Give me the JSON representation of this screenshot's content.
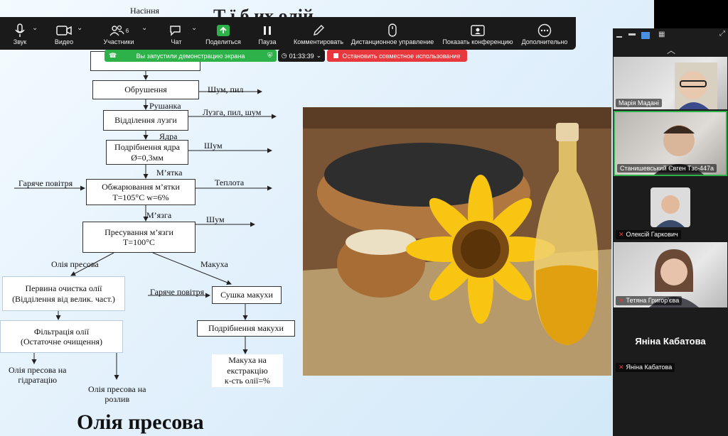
{
  "slide": {
    "title_fragment": "Т                ї       б                                     их олій",
    "top_label": "Насіння",
    "bottom_title": "Олія пресова",
    "boxes": {
      "obrushennya": "Обрушення",
      "viddilennya_luzgy": "Відділення лузги",
      "podribnennya_yadra": "Подрібнення ядра\nØ=0,3мм",
      "obzharyuvannya": "Обжарювання  м’ятки\nT=105°C  w=6%",
      "presuvannya": "Пресування м’язги\nT=100°C",
      "pervynna": "Первина очистка олії\n(Відділення від велик. част.)",
      "filtratsiya": "Фільтрація олії\n(Остаточне очищення)",
      "sushka": "Сушка макухи",
      "podribnennya_makukhy": "Подрібнення макухи"
    },
    "labels": {
      "shum_pyl": "Шум, пил",
      "rushanka": "Рушанка",
      "luzga_pyl_shum": "Лузга, пил, шум",
      "yadra": "Ядра",
      "shum1": "Шум",
      "myatka": "М’ятка",
      "gariache1": "Гаряче повітря",
      "teplota": "Теплота",
      "myazga": "М’язга",
      "shum2": "Шум",
      "oliya_presova": "Олія пресова",
      "makukha": "Макуха",
      "gariache2": "Гаряче повітря",
      "na_gidrataciyu": "Олія пресова на\nгідратацію",
      "na_rozlyv": "Олія пресова на\nрозлив",
      "makukha_extr": "Макуха на\nекстракцію\nк-сть олії=%"
    }
  },
  "toolbar": {
    "items": [
      {
        "label": "Звук",
        "icon": "microphone-icon"
      },
      {
        "label": "Видео",
        "icon": "camera-icon"
      },
      {
        "label": "Участники",
        "icon": "participants-icon",
        "count": "6"
      },
      {
        "label": "Чат",
        "icon": "chat-icon"
      },
      {
        "label": "Поделиться",
        "icon": "share-icon"
      },
      {
        "label": "Пауза",
        "icon": "pause-icon"
      },
      {
        "label": "Комментировать",
        "icon": "pen-icon"
      },
      {
        "label": "Дистанционное управление",
        "icon": "mouse-icon"
      },
      {
        "label": "Показать конференцию",
        "icon": "show-meeting-icon"
      },
      {
        "label": "Дополнительно",
        "icon": "more-icon"
      }
    ],
    "share_banner": "Вы запустили демонстрацию экрана",
    "timer": "01:33:39",
    "stop_share": "Остановить совместное использование"
  },
  "gallery": {
    "participants": [
      {
        "name": "Марія Мадані"
      },
      {
        "name": "Станишевський Євген Тзс-447а"
      },
      {
        "name": "Олексій Гаркович"
      },
      {
        "name": "Тетяна Григор'єва"
      },
      {
        "name": "Яніна Кабатова",
        "display": "Яніна Кабатова"
      }
    ]
  },
  "colors": {
    "green": "#2db24a",
    "red": "#e8383d",
    "toolbar": "#1a1a1a",
    "active_border": "#2db24a"
  }
}
